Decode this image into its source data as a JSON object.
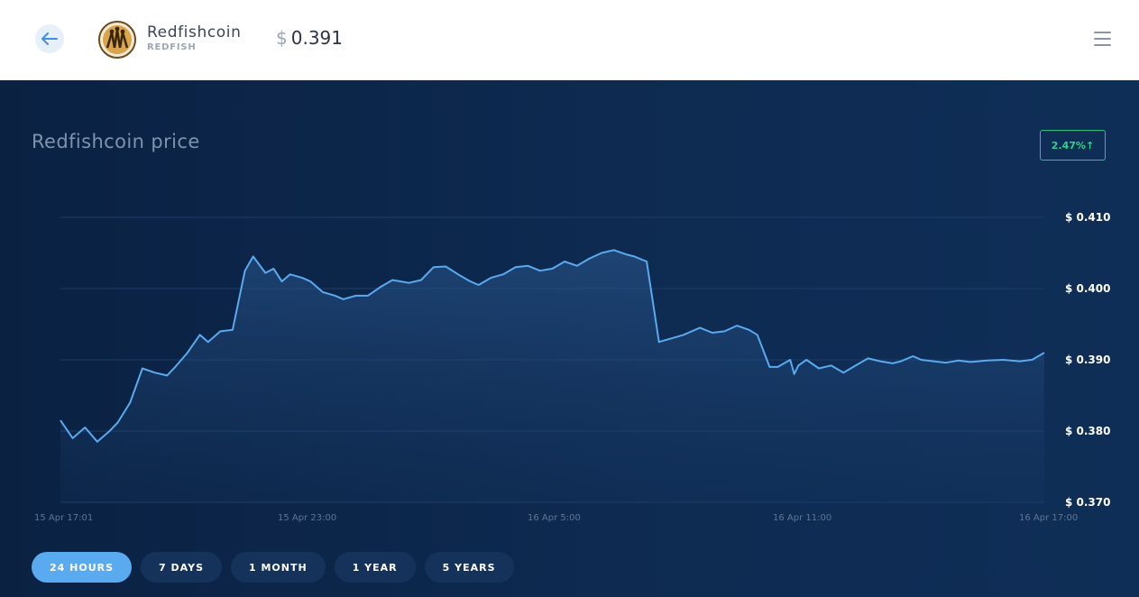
{
  "header": {
    "coin_name": "Redfishcoin",
    "coin_ticker": "REDFISH",
    "price_currency": "$",
    "price_value": "0.391"
  },
  "chart_panel": {
    "title": "Redfishcoin price",
    "change_badge": "2.47%↑"
  },
  "ranges": [
    {
      "label": "24 HOURS",
      "active": true
    },
    {
      "label": "7 DAYS",
      "active": false
    },
    {
      "label": "1 MONTH",
      "active": false
    },
    {
      "label": "1 YEAR",
      "active": false
    },
    {
      "label": "5 YEARS",
      "active": false
    }
  ],
  "colors": {
    "line": "#5aaaf0",
    "badge": "#2ec27e",
    "active_range": "#5aaaf0"
  },
  "chart_data": {
    "type": "area",
    "ylim": [
      0.37,
      0.41
    ],
    "y_ticks": [
      "$ 0.410",
      "$ 0.400",
      "$ 0.390",
      "$ 0.380",
      "$ 0.370"
    ],
    "y_tick_values": [
      0.41,
      0.4,
      0.39,
      0.38,
      0.37
    ],
    "x_ticks": [
      "15 Apr 17:01",
      "15 Apr 23:00",
      "16 Apr 5:00",
      "16 Apr 11:00",
      "16 Apr 17:00"
    ],
    "x_tick_hours": [
      0,
      6,
      12,
      18,
      24
    ],
    "series": [
      {
        "hours": [
          0,
          0.3,
          0.6,
          0.9,
          1.2,
          1.4,
          1.7,
          2.0,
          2.3,
          2.6,
          2.8,
          3.1,
          3.4,
          3.6,
          3.9,
          4.2,
          4.5,
          4.7,
          5.0,
          5.2,
          5.4,
          5.6,
          5.9,
          6.1,
          6.4,
          6.7,
          6.9,
          7.2,
          7.5,
          7.8,
          8.1,
          8.5,
          8.8,
          9.1,
          9.4,
          9.7,
          10.0,
          10.2,
          10.5,
          10.8,
          11.1,
          11.4,
          11.7,
          12.0,
          12.3,
          12.6,
          12.9,
          13.2,
          13.5,
          13.8,
          14.0,
          14.3,
          14.6,
          14.9,
          15.2,
          15.6,
          15.9,
          16.2,
          16.5,
          16.8,
          17.0,
          17.3,
          17.5,
          17.8,
          17.9,
          18.0,
          18.2,
          18.5,
          18.8,
          19.1,
          19.4,
          19.7,
          20.0,
          20.3,
          20.5,
          20.8,
          21.0,
          21.3,
          21.6,
          21.9,
          22.2,
          22.6,
          23.0,
          23.4,
          23.7,
          24.0
        ],
        "values": [
          0.3815,
          0.379,
          0.3805,
          0.3785,
          0.38,
          0.3812,
          0.384,
          0.3888,
          0.3882,
          0.3878,
          0.389,
          0.391,
          0.3935,
          0.3925,
          0.394,
          0.3942,
          0.4025,
          0.4045,
          0.4022,
          0.4028,
          0.401,
          0.402,
          0.4015,
          0.401,
          0.3995,
          0.399,
          0.3985,
          0.399,
          0.399,
          0.4002,
          0.4012,
          0.4008,
          0.4012,
          0.403,
          0.4031,
          0.402,
          0.401,
          0.4005,
          0.4015,
          0.402,
          0.403,
          0.4032,
          0.4025,
          0.4028,
          0.4038,
          0.4032,
          0.4042,
          0.405,
          0.4054,
          0.4048,
          0.4045,
          0.4038,
          0.3925,
          0.393,
          0.3935,
          0.3945,
          0.3938,
          0.394,
          0.3948,
          0.3942,
          0.3935,
          0.389,
          0.389,
          0.39,
          0.388,
          0.3892,
          0.39,
          0.3888,
          0.3892,
          0.3882,
          0.3892,
          0.3902,
          0.3898,
          0.3895,
          0.3898,
          0.3905,
          0.39,
          0.3898,
          0.3896,
          0.3899,
          0.3897,
          0.3899,
          0.39,
          0.3898,
          0.39,
          0.391
        ]
      }
    ]
  }
}
